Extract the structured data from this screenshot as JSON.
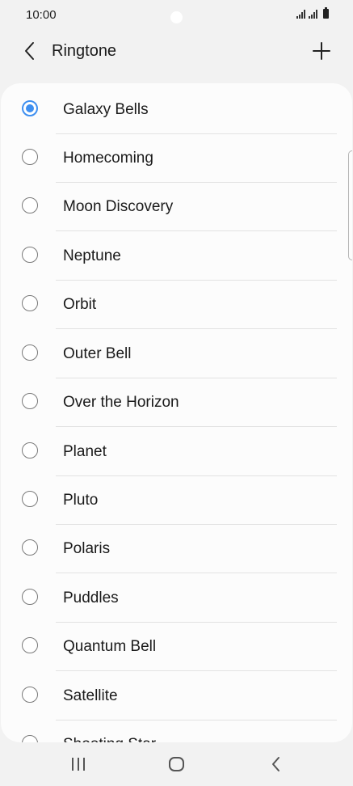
{
  "status_bar": {
    "time": "10:00"
  },
  "header": {
    "title": "Ringtone",
    "back_icon": "chevron-left-icon",
    "add_icon": "plus-icon"
  },
  "accent_color": "#3e8ff0",
  "ringtones": {
    "selected": "Galaxy Bells",
    "items": [
      {
        "label": "Galaxy Bells",
        "checked": true
      },
      {
        "label": "Homecoming",
        "checked": false
      },
      {
        "label": "Moon Discovery",
        "checked": false
      },
      {
        "label": "Neptune",
        "checked": false
      },
      {
        "label": "Orbit",
        "checked": false
      },
      {
        "label": "Outer Bell",
        "checked": false
      },
      {
        "label": "Over the Horizon",
        "checked": false
      },
      {
        "label": "Planet",
        "checked": false
      },
      {
        "label": "Pluto",
        "checked": false
      },
      {
        "label": "Polaris",
        "checked": false
      },
      {
        "label": "Puddles",
        "checked": false
      },
      {
        "label": "Quantum Bell",
        "checked": false
      },
      {
        "label": "Satellite",
        "checked": false
      },
      {
        "label": "Shooting Star",
        "checked": false
      }
    ]
  },
  "nav_bar": {
    "recents_icon": "recents-icon",
    "home_icon": "home-icon",
    "back_icon": "back-icon"
  }
}
